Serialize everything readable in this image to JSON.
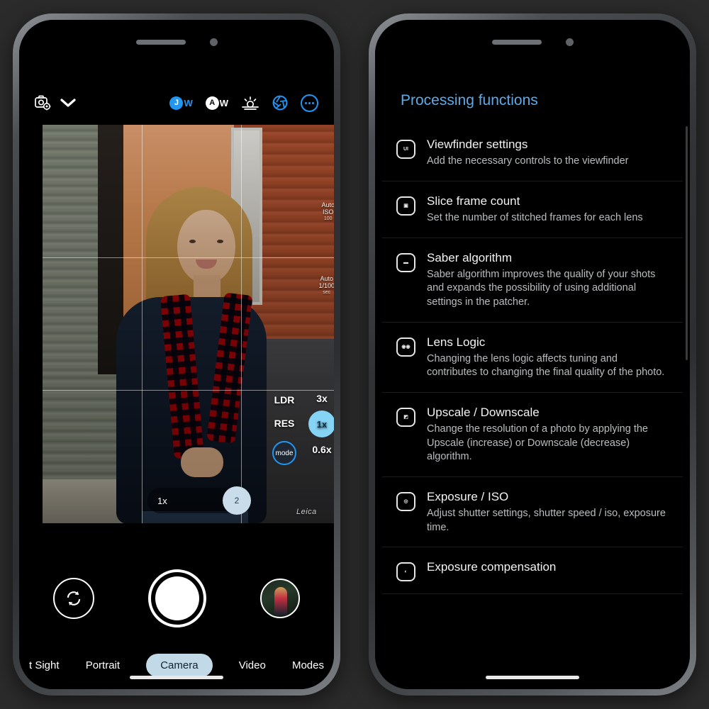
{
  "background_color": "#2b2b2b",
  "camera_phone": {
    "name": "camera-app-phone",
    "topbar": {
      "settings_icon": "camera-settings-icon",
      "expand_icon": "chevron-down-icon",
      "indicators": [
        {
          "id": "jw-badge",
          "badge": "J",
          "suffix": "W",
          "color": "#2196f3"
        },
        {
          "id": "aw-badge",
          "badge": "A",
          "suffix": "W",
          "color": "#ffffff"
        },
        {
          "id": "sunrise-icon",
          "badge": "",
          "suffix": "",
          "color": "#ffffff"
        },
        {
          "id": "aperture-icon",
          "badge": "",
          "suffix": "",
          "color": "#2196f3"
        }
      ],
      "more_label": "more-options-icon"
    },
    "viewfinder": {
      "meta_top": {
        "line1": "Auto",
        "line2": "ISO",
        "line3": "100"
      },
      "meta_bottom": {
        "line1": "Auto",
        "line2": "1/100",
        "line3": "sec"
      },
      "watermark": "Leica",
      "side_controls": [
        {
          "id": "ldr-toggle",
          "label": "LDR"
        },
        {
          "id": "res-toggle",
          "label": "RES"
        },
        {
          "id": "mode-toggle",
          "label": "mode"
        }
      ],
      "zoom_options": [
        {
          "id": "zoom-3x",
          "label": "3x",
          "active": false
        },
        {
          "id": "zoom-1x",
          "label": "1x",
          "active": true
        },
        {
          "id": "zoom-06x",
          "label": "0.6x",
          "active": false
        }
      ],
      "zoom_slider": {
        "value": "1x",
        "handle": "2"
      }
    },
    "controls": {
      "flip_label": "switch-camera-icon",
      "shutter_label": "shutter-button",
      "gallery_label": "gallery-thumbnail"
    },
    "modes": [
      {
        "id": "mode-night-sight",
        "label": "t Sight",
        "active": false
      },
      {
        "id": "mode-portrait",
        "label": "Portrait",
        "active": false
      },
      {
        "id": "mode-camera",
        "label": "Camera",
        "active": true
      },
      {
        "id": "mode-video",
        "label": "Video",
        "active": false
      },
      {
        "id": "mode-modes",
        "label": "Modes",
        "active": false
      }
    ],
    "accent_color": "#2196f3",
    "active_mode_bg": "#c2d9e8"
  },
  "settings_phone": {
    "name": "settings-list-phone",
    "title": "Processing functions",
    "title_color": "#5ea9e8",
    "items": [
      {
        "id": "viewfinder-settings",
        "icon": "ui-icon",
        "icon_glyph": "UI",
        "name": "Viewfinder settings",
        "desc": "Add the necessary controls to the viewfinder"
      },
      {
        "id": "slice-frame-count",
        "icon": "frames-icon",
        "icon_glyph": "▣",
        "name": "Slice frame count",
        "desc": "Set the number of stitched frames for each lens"
      },
      {
        "id": "saber-algorithm",
        "icon": "saber-icon",
        "icon_glyph": "▬",
        "name": "Saber algorithm",
        "desc": "Saber algorithm improves the quality of your shots and expands the possibility of using additional settings in the patcher."
      },
      {
        "id": "lens-logic",
        "icon": "lens-logic-icon",
        "icon_glyph": "◉◉",
        "name": "Lens Logic",
        "desc": "Changing the lens logic affects tuning and contributes to changing the final quality of the photo."
      },
      {
        "id": "upscale-downscale",
        "icon": "resize-icon",
        "icon_glyph": "◩",
        "name": "Upscale / Downscale",
        "desc": "Change the resolution of a photo by applying the Upscale (increase) or Downscale (decrease) algorithm."
      },
      {
        "id": "exposure-iso",
        "icon": "exposure-icon",
        "icon_glyph": "◎",
        "name": "Exposure / ISO",
        "desc": "Adjust shutter settings, shutter speed / iso, exposure time."
      },
      {
        "id": "exposure-compensation",
        "icon": "exposure-comp-icon",
        "icon_glyph": "◐",
        "name": "Exposure compensation",
        "desc": ""
      }
    ]
  }
}
